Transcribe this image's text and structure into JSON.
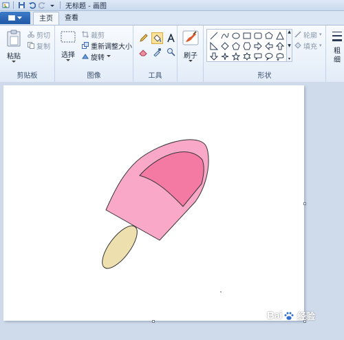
{
  "titlebar": {
    "title": "无标题 - 画图"
  },
  "tabs": {
    "file_label": "",
    "home": "主页",
    "view": "查看"
  },
  "clipboard": {
    "paste": "粘贴",
    "cut": "剪切",
    "copy": "复制",
    "group_label": "剪贴板"
  },
  "image": {
    "select": "选择",
    "crop": "裁剪",
    "resize": "重新调整大小",
    "rotate": "旋转",
    "group_label": "图像"
  },
  "tools": {
    "group_label": "工具",
    "active_tool": "fill-icon"
  },
  "brushes": {
    "label": "刷子"
  },
  "shapes": {
    "group_label": "形状",
    "outline": "轮廓",
    "fill": "填充"
  },
  "size": {
    "label": "粗细"
  },
  "drawing": {
    "icecream_light_pink": "#f9a8c8",
    "icecream_band_pink": "#f47aa4",
    "stick_color": "#eedfae",
    "outline_color": "#333333"
  },
  "watermark": {
    "brand": "Bai",
    "brand_end": "",
    "suffix": "经验"
  }
}
